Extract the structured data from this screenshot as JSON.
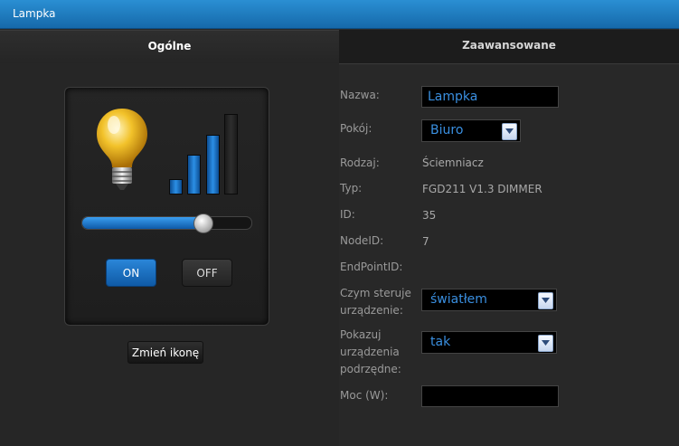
{
  "window": {
    "title": "Lampka"
  },
  "tabs": {
    "general": "Ogólne",
    "advanced": "Zaawansowane"
  },
  "device": {
    "icon": "light-bulb-icon",
    "signal_levels_active": 3,
    "signal_levels_total": 4,
    "slider_level": 0.71,
    "on_label": "ON",
    "off_label": "OFF",
    "change_icon_label": "Zmień ikonę"
  },
  "form": {
    "name_label": "Nazwa:",
    "name_value": "Lampka",
    "room_label": "Pokój:",
    "room_value": "Biuro",
    "type_label": "Rodzaj:",
    "type_value": "Ściemniacz",
    "model_label": "Typ:",
    "model_value": "FGD211 V1.3 DIMMER",
    "id_label": "ID:",
    "id_value": "35",
    "nodeid_label": "NodeID:",
    "nodeid_value": "7",
    "endpoint_label": "EndPointID:",
    "controls_label": "Czym steruje urządzenie:",
    "controls_value": "światłem",
    "show_sub_label": "Pokazuj urządzenia podrzędne:",
    "show_sub_value": "tak",
    "power_label": "Moc (W):",
    "power_value": ""
  },
  "colors": {
    "accent": "#2a86d8",
    "title_bar": "#1c7bc0",
    "input_text": "#3a8fe0"
  }
}
